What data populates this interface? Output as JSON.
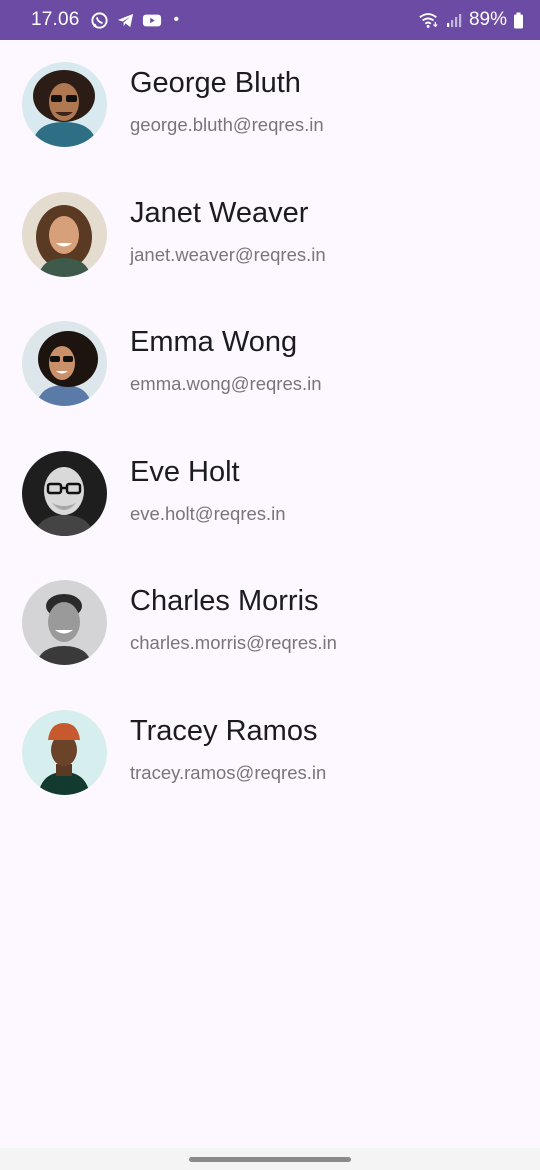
{
  "status_bar": {
    "time": "17.06",
    "dot": "•",
    "battery": "89%",
    "icons": [
      "whatsapp-icon",
      "telegram-icon",
      "youtube-icon",
      "wifi-icon",
      "signal-icon",
      "battery-icon"
    ],
    "background": "#6b4ba3"
  },
  "users": [
    {
      "name": "George Bluth",
      "email": "george.bluth@reqres.in"
    },
    {
      "name": "Janet Weaver",
      "email": "janet.weaver@reqres.in"
    },
    {
      "name": "Emma Wong",
      "email": "emma.wong@reqres.in"
    },
    {
      "name": "Eve Holt",
      "email": "eve.holt@reqres.in"
    },
    {
      "name": "Charles Morris",
      "email": "charles.morris@reqres.in"
    },
    {
      "name": "Tracey Ramos",
      "email": "tracey.ramos@reqres.in"
    }
  ],
  "colors": {
    "background": "#fdf7ff",
    "name_text": "#1c1b1f",
    "email_text": "#79747e"
  }
}
